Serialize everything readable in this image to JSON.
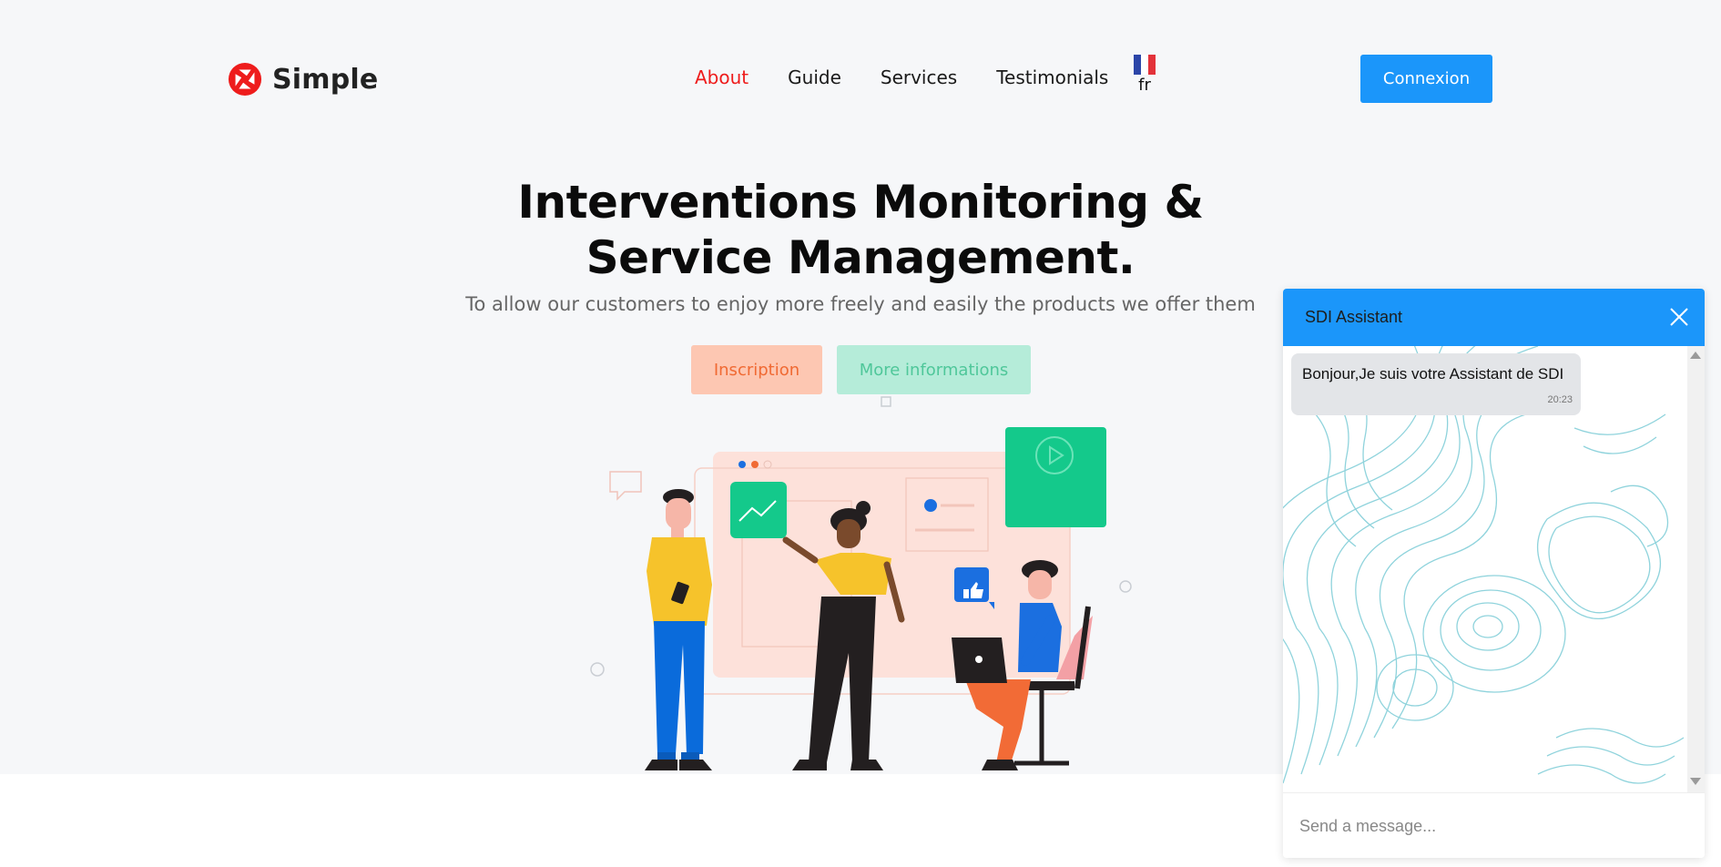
{
  "header": {
    "logo_text": "Simple",
    "nav": [
      {
        "label": "About",
        "active": true
      },
      {
        "label": "Guide",
        "active": false
      },
      {
        "label": "Services",
        "active": false
      },
      {
        "label": "Testimonials",
        "active": false
      }
    ],
    "language": "fr",
    "connexion_label": "Connexion"
  },
  "hero": {
    "title_line1": "Interventions Monitoring &",
    "title_line2": "Service Management.",
    "subtitle": "To allow our customers to enjoy more freely and easily the products we offer them",
    "inscription_label": "Inscription",
    "more_label": "More informations"
  },
  "chat": {
    "title": "SDI Assistant",
    "messages": [
      {
        "text": "Bonjour,Je suis votre Assistant de SDI",
        "time": "20:23"
      }
    ],
    "input_placeholder": "Send a message..."
  },
  "colors": {
    "accent_blue": "#1b96fa",
    "brand_red": "#ee1c1c",
    "inscription_bg": "#fdc7b2",
    "more_bg": "#b5ecd9",
    "page_bg": "#f6f7f9"
  },
  "icons": {
    "logo": "camera-shutter-icon",
    "flag": "france-flag-icon",
    "close": "close-icon"
  }
}
